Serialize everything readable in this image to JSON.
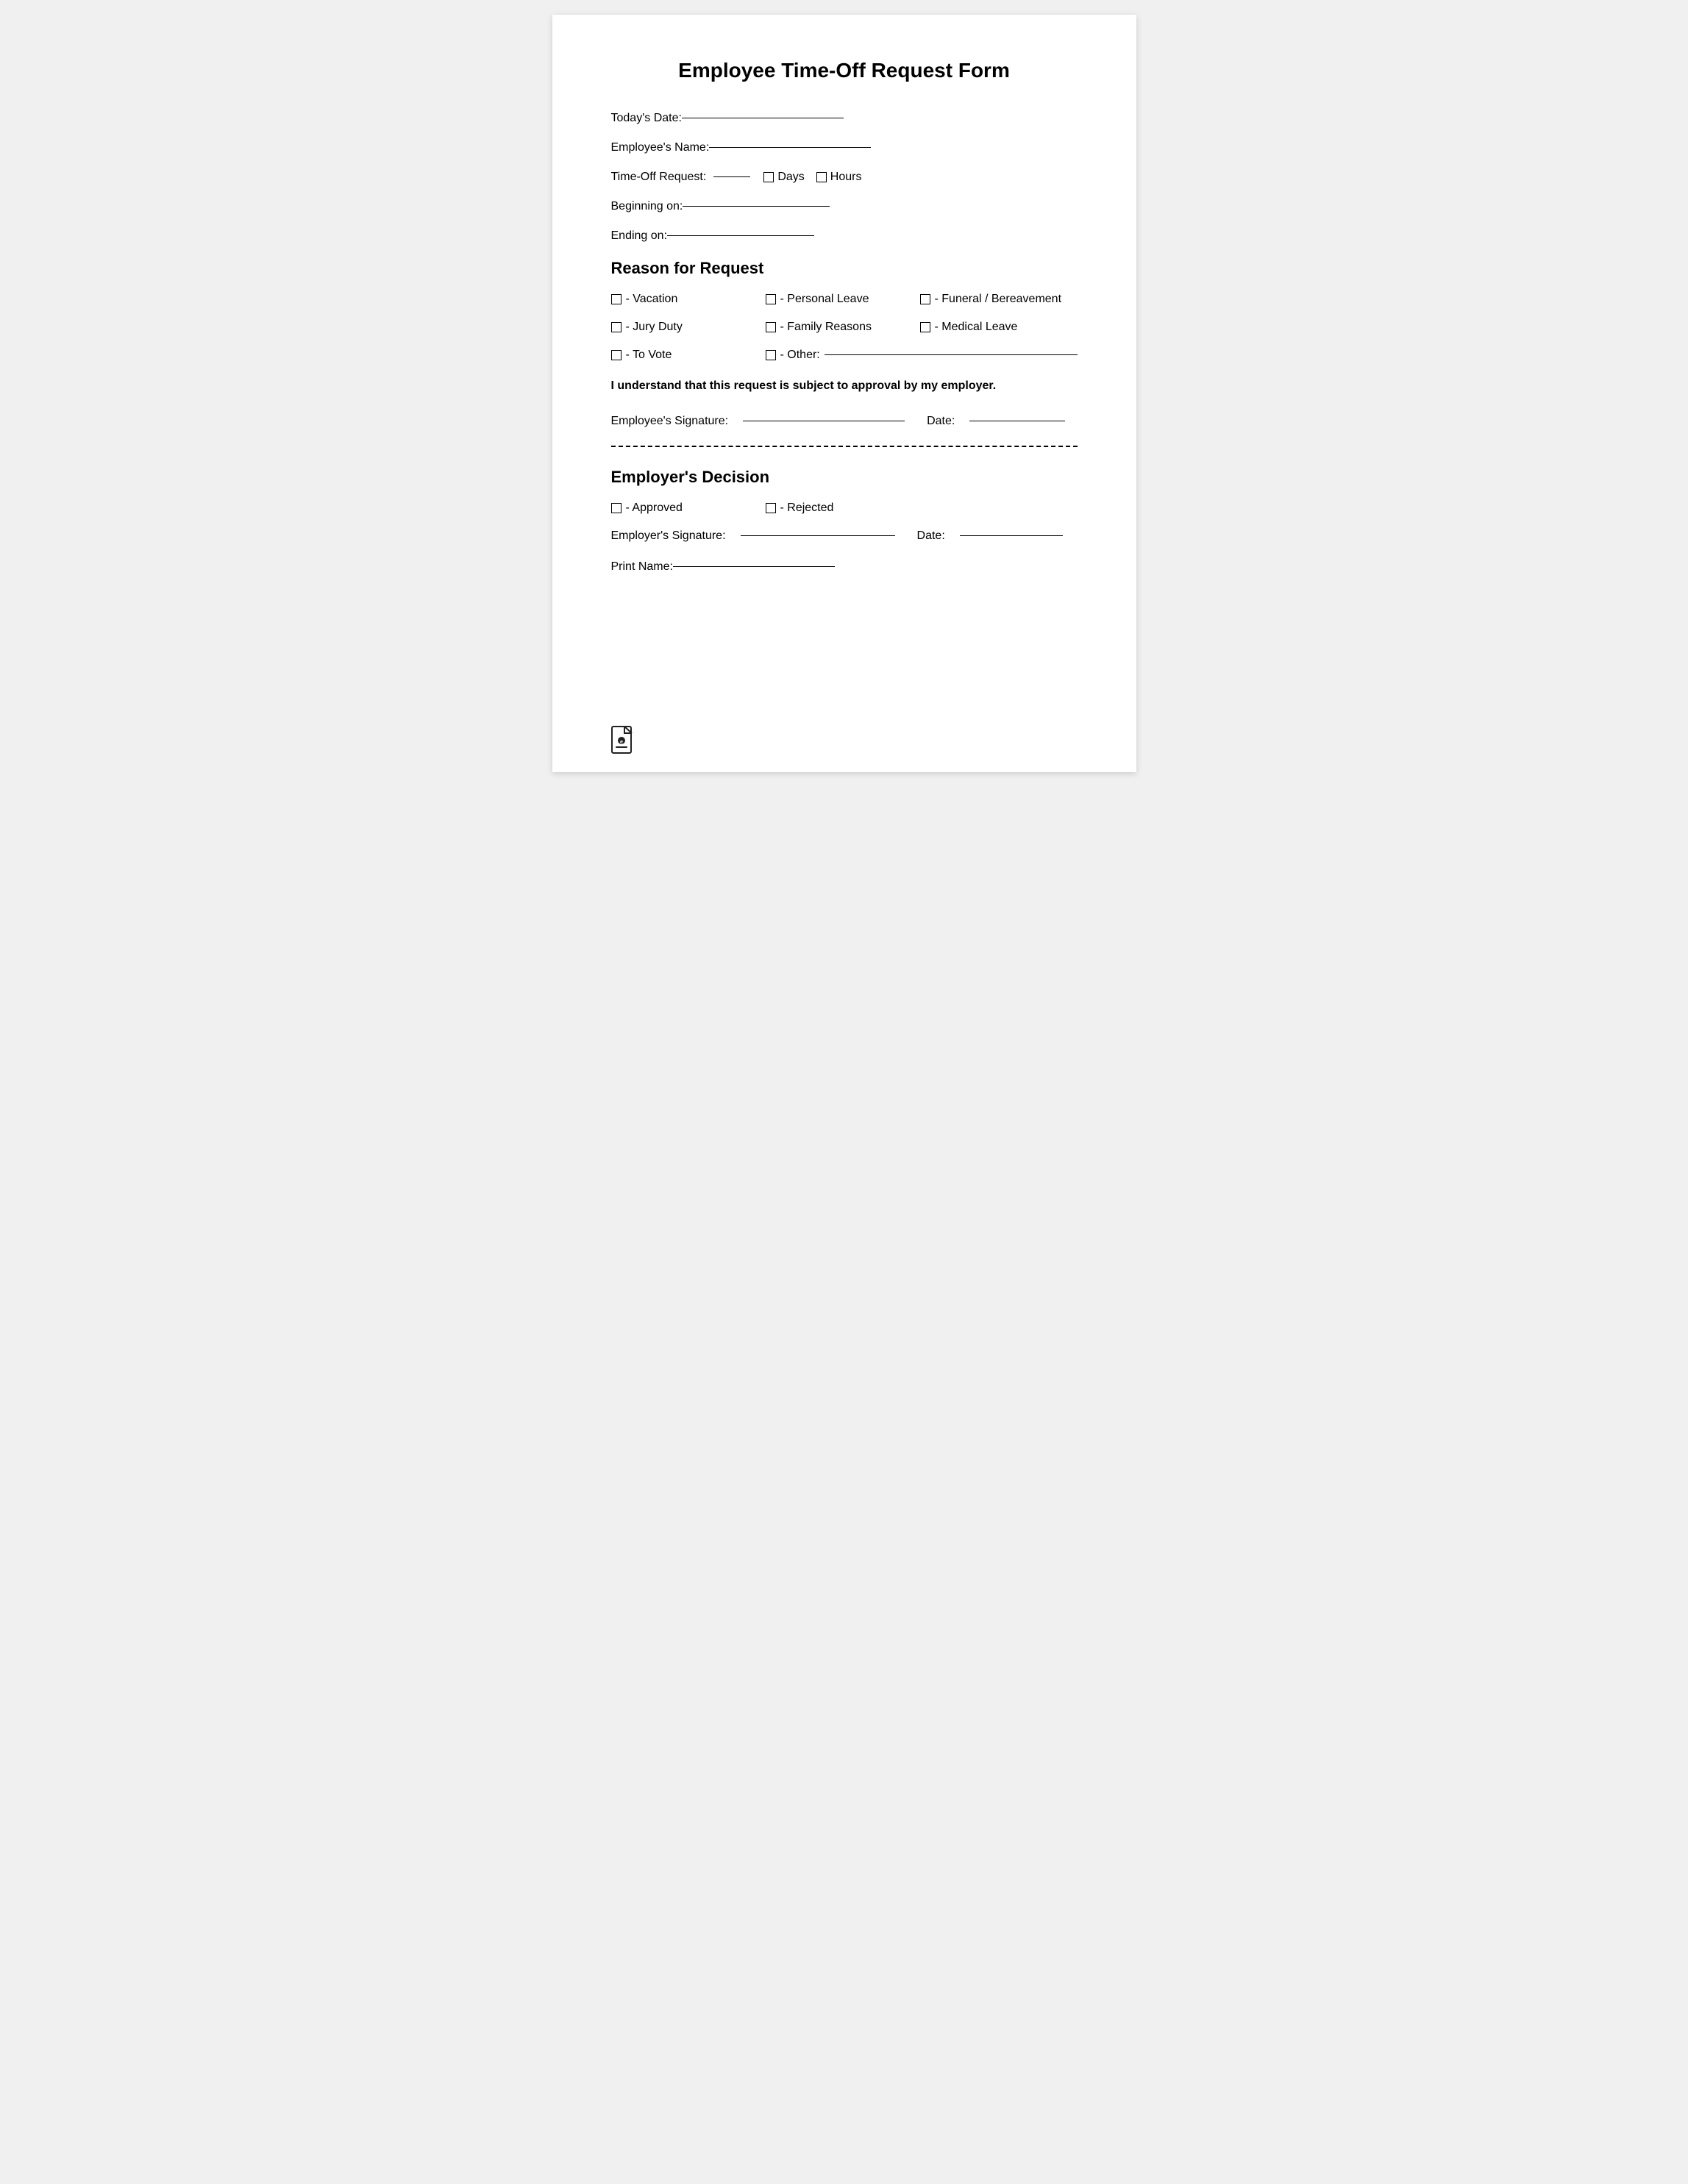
{
  "title": "Employee Time-Off Request Form",
  "fields": {
    "todays_date_label": "Today's Date:",
    "employees_name_label": "Employee's Name:",
    "timeoff_request_label": "Time-Off Request:",
    "days_label": "Days",
    "hours_label": "Hours",
    "beginning_on_label": "Beginning on:",
    "ending_on_label": "Ending on:"
  },
  "reason_section": {
    "heading": "Reason for Request",
    "row1": [
      {
        "label": "- Vacation"
      },
      {
        "label": "- Personal Leave"
      },
      {
        "label": "- Funeral / Bereavement"
      }
    ],
    "row2": [
      {
        "label": "- Jury Duty"
      },
      {
        "label": "- Family Reasons"
      },
      {
        "label": "- Medical Leave"
      }
    ],
    "row3_item1": "- To Vote",
    "row3_item2_label": "- Other:"
  },
  "approval_text": "I understand that this request is subject to approval by my employer.",
  "employee_signature": {
    "label": "Employee's Signature:",
    "date_label": "Date:"
  },
  "employer_section": {
    "heading": "Employer's Decision",
    "approved_label": "- Approved",
    "rejected_label": "- Rejected",
    "signature_label": "Employer's Signature:",
    "date_label": "Date:",
    "print_name_label": "Print Name:"
  }
}
